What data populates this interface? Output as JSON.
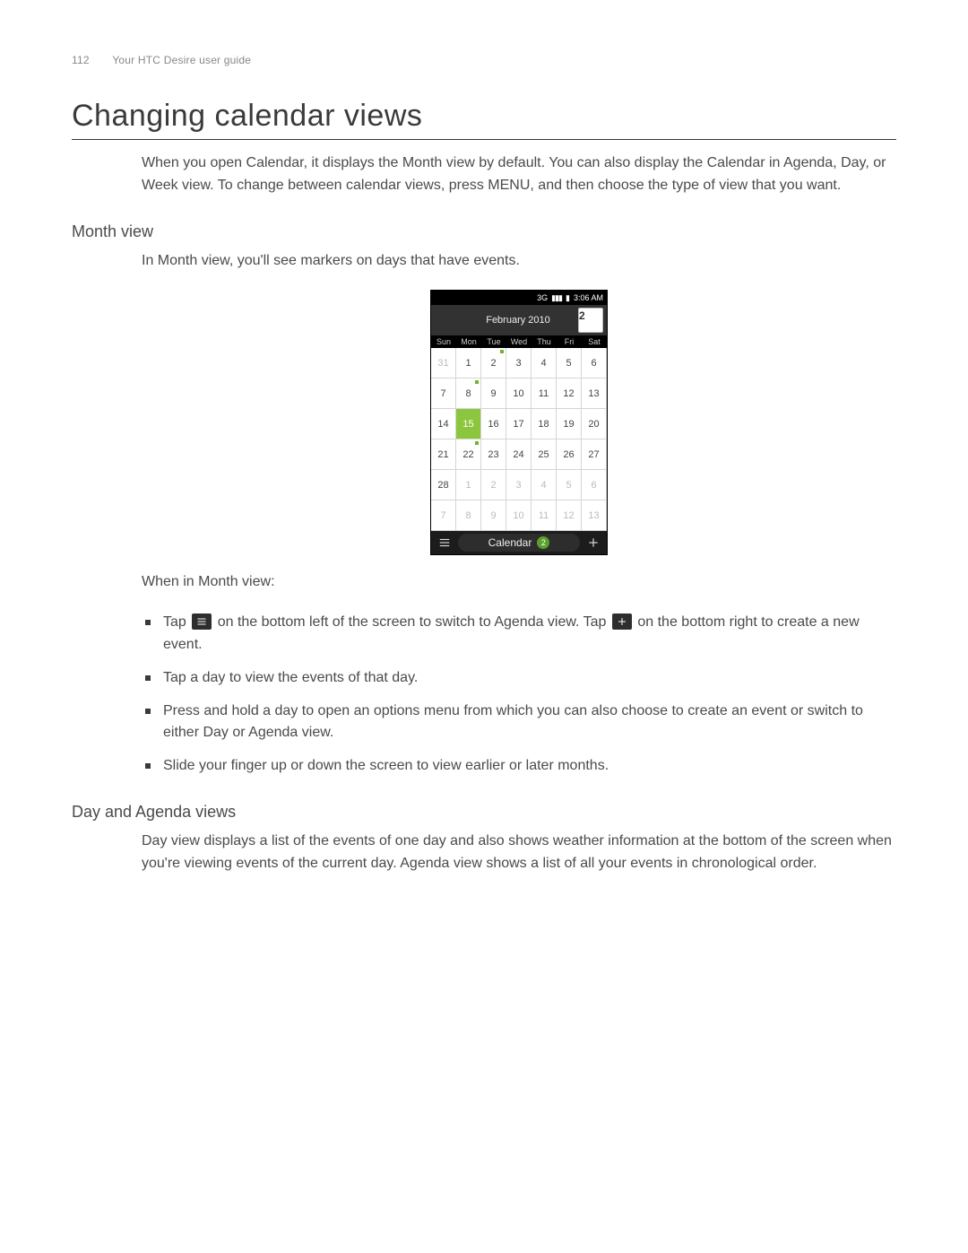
{
  "header": {
    "page_number": "112",
    "guide_title": "Your HTC Desire user guide"
  },
  "title": "Changing calendar views",
  "intro": "When you open Calendar, it displays the Month view by default. You can also display the Calendar in Agenda, Day, or Week view. To change between calendar views, press MENU, and then choose the type of view that you want.",
  "month_view": {
    "heading": "Month view",
    "line1": "In Month view, you'll see markers on days that have events.",
    "after_image_intro": "When in Month view:",
    "bullets": {
      "b1a": "Tap ",
      "b1b": " on the bottom left of the screen to switch to Agenda view. Tap ",
      "b1c": " on the bottom right to create a new event.",
      "b2": "Tap a day to view the events of that day.",
      "b3": "Press and hold a day to open an options menu from which you can also choose to create an event or switch to either Day or Agenda view.",
      "b4": "Slide your finger up or down the screen to view earlier or later months."
    }
  },
  "day_agenda": {
    "heading": "Day and Agenda views",
    "para": "Day view displays a list of the events of one day and also shows weather information at the bottom of the screen when you're viewing events of the current day. Agenda view shows a list of all your events in chronological order."
  },
  "phone": {
    "status_time": "3:06 AM",
    "status_net": "3G",
    "month_title": "February 2010",
    "tear_day": "2",
    "dow": [
      "Sun",
      "Mon",
      "Tue",
      "Wed",
      "Thu",
      "Fri",
      "Sat"
    ],
    "grid": [
      {
        "n": "31",
        "dim": true
      },
      {
        "n": "1"
      },
      {
        "n": "2",
        "mark": true
      },
      {
        "n": "3"
      },
      {
        "n": "4"
      },
      {
        "n": "5"
      },
      {
        "n": "6"
      },
      {
        "n": "7"
      },
      {
        "n": "8",
        "mark": true
      },
      {
        "n": "9"
      },
      {
        "n": "10"
      },
      {
        "n": "11"
      },
      {
        "n": "12"
      },
      {
        "n": "13"
      },
      {
        "n": "14"
      },
      {
        "n": "15",
        "selected": true
      },
      {
        "n": "16"
      },
      {
        "n": "17"
      },
      {
        "n": "18"
      },
      {
        "n": "19"
      },
      {
        "n": "20"
      },
      {
        "n": "21"
      },
      {
        "n": "22",
        "mark": true
      },
      {
        "n": "23"
      },
      {
        "n": "24"
      },
      {
        "n": "25"
      },
      {
        "n": "26"
      },
      {
        "n": "27"
      },
      {
        "n": "28"
      },
      {
        "n": "1",
        "dim": true
      },
      {
        "n": "2",
        "dim": true
      },
      {
        "n": "3",
        "dim": true
      },
      {
        "n": "4",
        "dim": true
      },
      {
        "n": "5",
        "dim": true
      },
      {
        "n": "6",
        "dim": true
      },
      {
        "n": "7",
        "dim": true
      },
      {
        "n": "8",
        "dim": true
      },
      {
        "n": "9",
        "dim": true
      },
      {
        "n": "10",
        "dim": true
      },
      {
        "n": "11",
        "dim": true
      },
      {
        "n": "12",
        "dim": true
      },
      {
        "n": "13",
        "dim": true
      }
    ],
    "bottom_label": "Calendar",
    "badge": "2"
  }
}
